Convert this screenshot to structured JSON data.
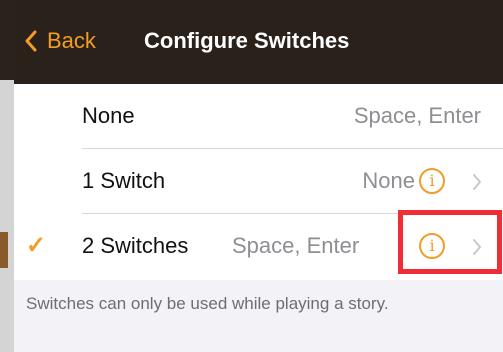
{
  "nav": {
    "back_label": "Back",
    "title": "Configure Switches",
    "accent_color": "#f39c26"
  },
  "rows": [
    {
      "label": "None",
      "value": "Space, Enter",
      "checked": false,
      "has_info": false
    },
    {
      "label": "1 Switch",
      "value": "None",
      "checked": false,
      "has_info": true
    },
    {
      "label": "2 Switches",
      "value": "Space, Enter",
      "checked": true,
      "has_info": true,
      "highlighted": true
    }
  ],
  "checkmark_glyph": "✓",
  "info_glyph": "i",
  "footer_note": "Switches can only be used while playing a story.",
  "icons": {
    "back": "chevron-left-icon",
    "info": "info-circle-icon",
    "disclosure": "chevron-right-icon",
    "check": "checkmark-icon"
  },
  "colors": {
    "nav_background": "#2a211b",
    "accent": "#f39c26",
    "highlight": "#ef2d34",
    "secondary_text": "#8e8e93"
  }
}
